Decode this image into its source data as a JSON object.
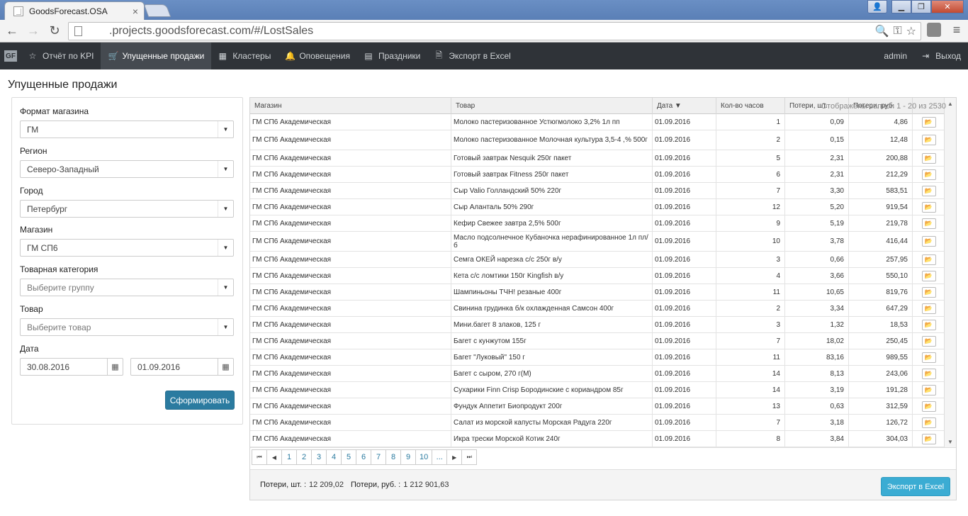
{
  "browser": {
    "tab_title": "GoodsForecast.OSA",
    "tab_close": "×",
    "url": ".projects.goodsforecast.com/#/LostSales"
  },
  "navbar": {
    "items": [
      {
        "label": "Отчёт по KPI",
        "icon": "star-icon"
      },
      {
        "label": "Упущенные продажи",
        "icon": "cart-icon",
        "active": true
      },
      {
        "label": "Кластеры",
        "icon": "table-icon"
      },
      {
        "label": "Оповещения",
        "icon": "bell-icon"
      },
      {
        "label": "Праздники",
        "icon": "calendar-icon"
      },
      {
        "label": "Экспорт в Excel",
        "icon": "file-excel-icon"
      }
    ],
    "user": "admin",
    "logout": "Выход"
  },
  "page": {
    "title": "Упущенные продажи"
  },
  "filters": {
    "store_format": {
      "label": "Формат магазина",
      "value": "ГМ"
    },
    "region": {
      "label": "Регион",
      "value": "Северо-Западный"
    },
    "city": {
      "label": "Город",
      "value": "Петербург"
    },
    "store": {
      "label": "Магазин",
      "value": "ГМ СП6"
    },
    "category": {
      "label": "Товарная категория",
      "placeholder": "Выберите группу"
    },
    "product": {
      "label": "Товар",
      "placeholder": "Выберите товар"
    },
    "date": {
      "label": "Дата",
      "from": "30.08.2016",
      "to": "01.09.2016"
    },
    "submit_label": "Сформировать"
  },
  "grid": {
    "columns": [
      "Магазин",
      "Товар",
      "Дата ▼",
      "Кол-во часов",
      "Потери, шт.",
      "Потери, руб."
    ],
    "rows": [
      {
        "store": "ГМ СП6 Академическая",
        "product": "Молоко пастеризованное Устюгмолоко 3,2% 1л пп",
        "date": "01.09.2016",
        "hours": "1",
        "loss_qty": "0,09",
        "loss_rub": "4,86"
      },
      {
        "store": "ГМ СП6 Академическая",
        "product": "Молоко пастеризованное Молочная культура 3,5-4 ,% 500г",
        "date": "01.09.2016",
        "hours": "2",
        "loss_qty": "0,15",
        "loss_rub": "12,48",
        "tall": true
      },
      {
        "store": "ГМ СП6 Академическая",
        "product": "Готовый завтрак Nesquik 250г пакет",
        "date": "01.09.2016",
        "hours": "5",
        "loss_qty": "2,31",
        "loss_rub": "200,88"
      },
      {
        "store": "ГМ СП6 Академическая",
        "product": "Готовый завтрак Fitness 250г пакет",
        "date": "01.09.2016",
        "hours": "6",
        "loss_qty": "2,31",
        "loss_rub": "212,29"
      },
      {
        "store": "ГМ СП6 Академическая",
        "product": "Сыр Valio Голландский 50% 220г",
        "date": "01.09.2016",
        "hours": "7",
        "loss_qty": "3,30",
        "loss_rub": "583,51"
      },
      {
        "store": "ГМ СП6 Академическая",
        "product": "Сыр Аланталь 50% 290г",
        "date": "01.09.2016",
        "hours": "12",
        "loss_qty": "5,20",
        "loss_rub": "919,54"
      },
      {
        "store": "ГМ СП6 Академическая",
        "product": "Кефир Свежее завтра 2,5% 500г",
        "date": "01.09.2016",
        "hours": "9",
        "loss_qty": "5,19",
        "loss_rub": "219,78"
      },
      {
        "store": "ГМ СП6 Академическая",
        "product": "Масло подсолнечное Кубаночка нерафинированное 1л пл/б",
        "date": "01.09.2016",
        "hours": "10",
        "loss_qty": "3,78",
        "loss_rub": "416,44",
        "tall": true
      },
      {
        "store": "ГМ СП6 Академическая",
        "product": "Семга ОКЕЙ нарезка с/с 250г в/у",
        "date": "01.09.2016",
        "hours": "3",
        "loss_qty": "0,66",
        "loss_rub": "257,95"
      },
      {
        "store": "ГМ СП6 Академическая",
        "product": "Кета с/с ломтики 150г Kingfish в/у",
        "date": "01.09.2016",
        "hours": "4",
        "loss_qty": "3,66",
        "loss_rub": "550,10"
      },
      {
        "store": "ГМ СП6 Академическая",
        "product": "Шампиньоны ТЧН! резаные 400г",
        "date": "01.09.2016",
        "hours": "11",
        "loss_qty": "10,65",
        "loss_rub": "819,76"
      },
      {
        "store": "ГМ СП6 Академическая",
        "product": "Свинина грудинка б/к охлажденная Самсон 400г",
        "date": "01.09.2016",
        "hours": "2",
        "loss_qty": "3,34",
        "loss_rub": "647,29"
      },
      {
        "store": "ГМ СП6 Академическая",
        "product": "Мини.багет 8 злаков, 125 г",
        "date": "01.09.2016",
        "hours": "3",
        "loss_qty": "1,32",
        "loss_rub": "18,53"
      },
      {
        "store": "ГМ СП6 Академическая",
        "product": "Багет с кунжутом 155г",
        "date": "01.09.2016",
        "hours": "7",
        "loss_qty": "18,02",
        "loss_rub": "250,45"
      },
      {
        "store": "ГМ СП6 Академическая",
        "product": "Багет \"Луковый\" 150 г",
        "date": "01.09.2016",
        "hours": "11",
        "loss_qty": "83,16",
        "loss_rub": "989,55"
      },
      {
        "store": "ГМ СП6 Академическая",
        "product": "Багет с сыром, 270 г(М)",
        "date": "01.09.2016",
        "hours": "14",
        "loss_qty": "8,13",
        "loss_rub": "243,06"
      },
      {
        "store": "ГМ СП6 Академическая",
        "product": "Сухарики Finn Crisp Бородинские с кориандром 85г",
        "date": "01.09.2016",
        "hours": "14",
        "loss_qty": "3,19",
        "loss_rub": "191,28"
      },
      {
        "store": "ГМ СП6 Академическая",
        "product": "Фундук Аппетит Биопродукт 200г",
        "date": "01.09.2016",
        "hours": "13",
        "loss_qty": "0,63",
        "loss_rub": "312,59"
      },
      {
        "store": "ГМ СП6 Академическая",
        "product": "Салат из морской капусты Морская Радуга 220г",
        "date": "01.09.2016",
        "hours": "7",
        "loss_qty": "3,18",
        "loss_rub": "126,72"
      },
      {
        "store": "ГМ СП6 Академическая",
        "product": "Икра трески Морской Котик 240г",
        "date": "01.09.2016",
        "hours": "8",
        "loss_qty": "3,84",
        "loss_rub": "304,03"
      }
    ]
  },
  "pager": {
    "pages": [
      "1",
      "2",
      "3",
      "4",
      "5",
      "6",
      "7",
      "8",
      "9",
      "10",
      "..."
    ],
    "info": "Отображены записи 1 - 20 из 2530"
  },
  "totals": {
    "qty_label": "Потери, шт. :",
    "qty_value": "12 209,02",
    "rub_label": "Потери, руб. :",
    "rub_value": "1 212 901,63",
    "export_label": "Экспорт в Excel"
  },
  "colors": {
    "navbar_bg": "#2f3338",
    "navbar_active": "#454a50",
    "primary_button": "#2b7ba0",
    "excel_button": "#3bacd3"
  }
}
